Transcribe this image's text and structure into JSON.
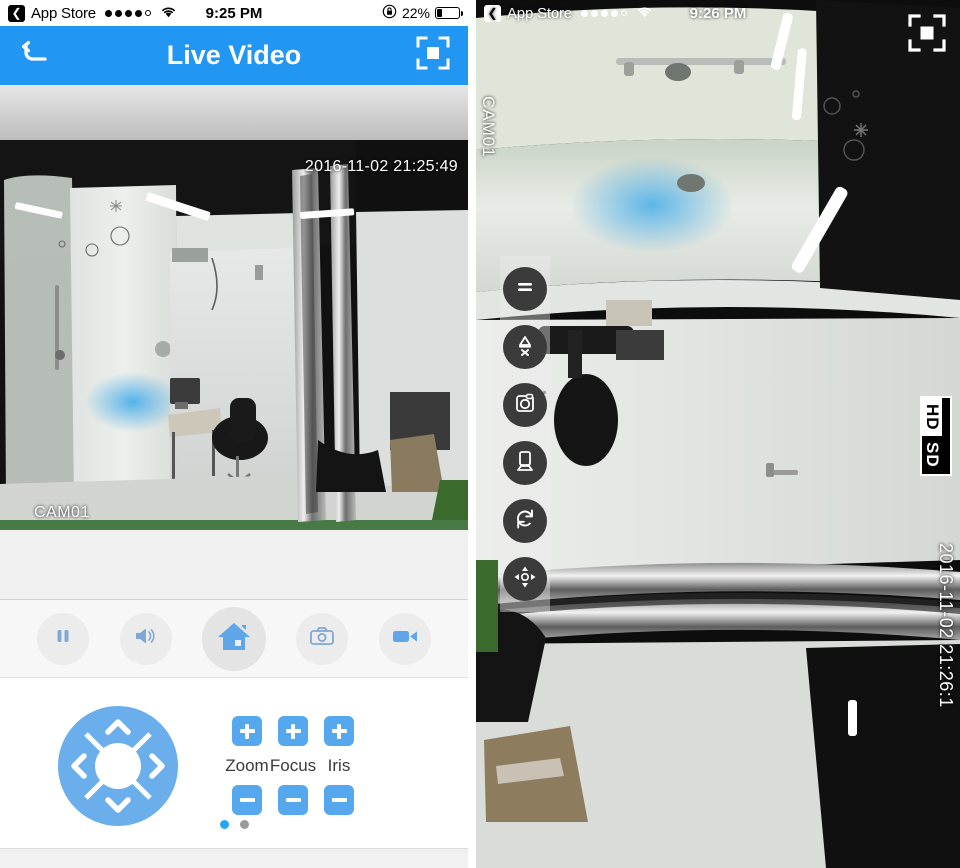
{
  "app": {
    "name": "Live Video",
    "accent_color": "#2196f3",
    "button_blue": "#55a8ee"
  },
  "left_panel": {
    "status_bar": {
      "back_chip_icon": "chevron-left-icon",
      "carrier": "App Store",
      "signal_icon": "signal-dots-icon",
      "wifi_icon": "wifi-icon",
      "time": "9:25 PM",
      "rotation_lock_icon": "rotation-lock-icon",
      "battery_percent": "22%",
      "battery_level": 22,
      "battery_icon": "battery-icon"
    },
    "nav_bar": {
      "back_icon": "back-arrow-icon",
      "title": "Live Video",
      "fullscreen_icon": "fullscreen-icon"
    },
    "video": {
      "timestamp": "2016-11-02 21:25:49",
      "camera_label": "CAM01"
    },
    "controls": [
      {
        "name": "pause-button",
        "icon": "pause-icon",
        "label": "Pause",
        "size": "small"
      },
      {
        "name": "audio-button",
        "icon": "speaker-icon",
        "label": "Audio",
        "size": "small"
      },
      {
        "name": "home-button",
        "icon": "home-icon",
        "label": "Home",
        "size": "large"
      },
      {
        "name": "snapshot-button",
        "icon": "camera-icon",
        "label": "Snapshot",
        "size": "small"
      },
      {
        "name": "record-button",
        "icon": "video-camera-icon",
        "label": "Record",
        "size": "small"
      }
    ],
    "ptz": {
      "joystick_icon": "dpad-joystick-icon",
      "up_icon": "chevron-up-icon",
      "down_icon": "chevron-down-icon",
      "left_icon": "chevron-left-icon",
      "right_icon": "chevron-right-icon",
      "lens_controls": [
        {
          "label": "Zoom",
          "plus_icon": "plus-icon",
          "minus_icon": "minus-icon"
        },
        {
          "label": "Focus",
          "plus_icon": "plus-icon",
          "minus_icon": "minus-icon"
        },
        {
          "label": "Iris",
          "plus_icon": "plus-icon",
          "minus_icon": "minus-icon"
        }
      ]
    },
    "pager": {
      "total": 2,
      "active_index": 0
    }
  },
  "right_panel": {
    "status_bar": {
      "back_chip_icon": "chevron-left-icon",
      "carrier": "App Store",
      "signal_icon": "signal-dots-icon",
      "wifi_icon": "wifi-icon",
      "time": "9:26 PM"
    },
    "fullscreen_icon": "fullscreen-icon",
    "video": {
      "camera_label": "CAM01",
      "timestamp": "2016-11-02 21:26:1"
    },
    "toolbar": [
      {
        "name": "pause-tool",
        "icon": "pause-icon",
        "label": "Pause"
      },
      {
        "name": "mute-tool",
        "icon": "speaker-muted-icon",
        "label": "Mute"
      },
      {
        "name": "snapshot-tool",
        "icon": "camera-icon",
        "label": "Snapshot"
      },
      {
        "name": "record-tool",
        "icon": "video-camera-icon",
        "label": "Record"
      },
      {
        "name": "rotate-tool",
        "icon": "rotate-icon",
        "label": "Rotate"
      },
      {
        "name": "ptz-tool",
        "icon": "dpad-icon",
        "label": "PTZ"
      }
    ],
    "quality": {
      "options": [
        "HD",
        "SD"
      ],
      "selected": "HD"
    }
  }
}
